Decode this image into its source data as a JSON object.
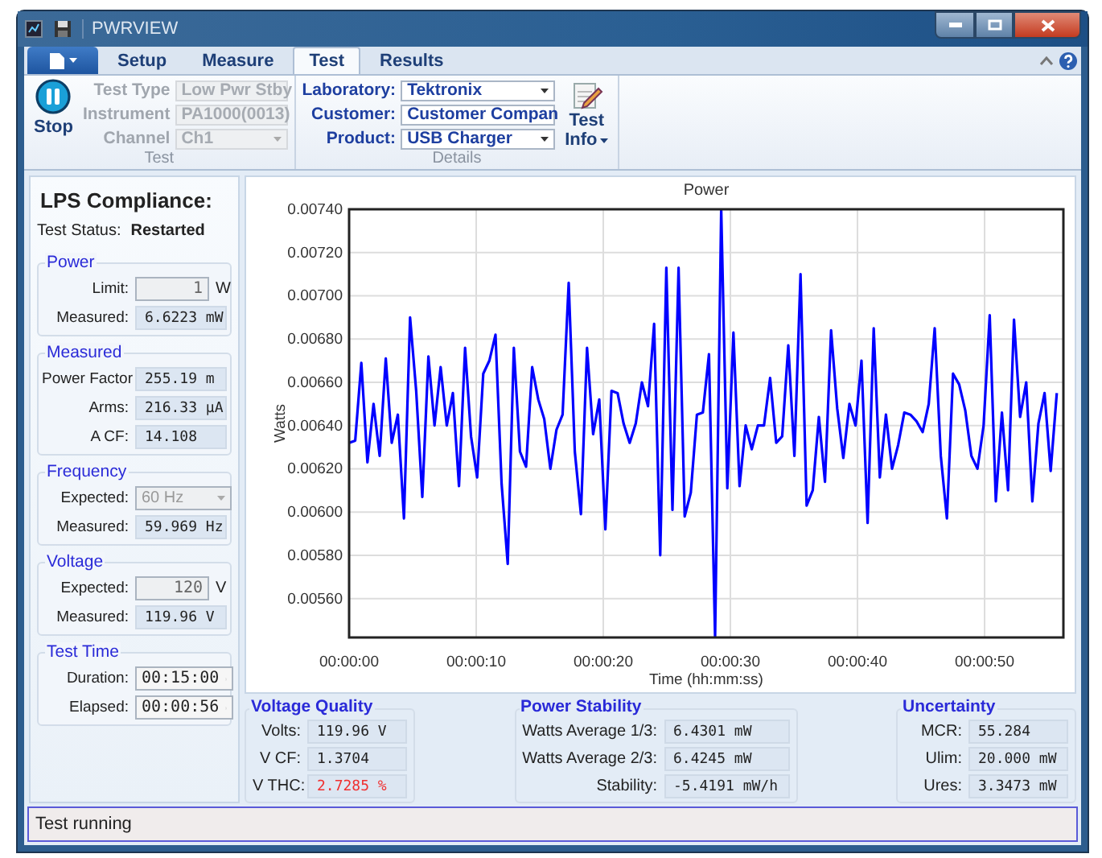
{
  "window": {
    "title": "PWRVIEW"
  },
  "ribbon": {
    "tabs": [
      {
        "label": "Setup",
        "selected": false
      },
      {
        "label": "Measure",
        "selected": false
      },
      {
        "label": "Test",
        "selected": true
      },
      {
        "label": "Results",
        "selected": false
      }
    ],
    "test_group": {
      "label": "Test",
      "stop_button": "Stop",
      "fields": [
        {
          "label": "Test Type",
          "value": "Low Pwr Stby",
          "disabled": true
        },
        {
          "label": "Instrument",
          "value": "PA1000(0013)",
          "disabled": true
        },
        {
          "label": "Channel",
          "value": "Ch1",
          "disabled": true
        }
      ]
    },
    "details_group": {
      "label": "Details",
      "fields": [
        {
          "label": "Laboratory:",
          "value": "Tektronix",
          "disabled": false
        },
        {
          "label": "Customer:",
          "value": "Customer Compan",
          "disabled": false
        },
        {
          "label": "Product:",
          "value": "USB Charger",
          "disabled": false
        }
      ],
      "info_button": [
        "Test",
        "Info"
      ]
    }
  },
  "left_panel": {
    "title": "LPS Compliance:",
    "status_label": "Test Status:",
    "status_value": "Restarted",
    "sections": [
      {
        "title": "Power",
        "rows": [
          {
            "kind": "input",
            "label": "Limit:",
            "value": "1",
            "unit": "W"
          },
          {
            "kind": "readout",
            "label": "Measured:",
            "value": "6.6223 mW"
          }
        ]
      },
      {
        "title": "Measured",
        "rows": [
          {
            "kind": "readout",
            "label": "Power Factor",
            "value": "255.19 m"
          },
          {
            "kind": "readout",
            "label": "Arms:",
            "value": "216.33 µA"
          },
          {
            "kind": "readout",
            "label": "A CF:",
            "value": "14.108"
          }
        ]
      },
      {
        "title": "Frequency",
        "rows": [
          {
            "kind": "select",
            "label": "Expected:",
            "value": "60 Hz",
            "disabled": true
          },
          {
            "kind": "readout",
            "label": "Measured:",
            "value": "59.969 Hz"
          }
        ]
      },
      {
        "title": "Voltage",
        "rows": [
          {
            "kind": "input",
            "label": "Expected:",
            "value": "120",
            "unit": "V"
          },
          {
            "kind": "readout",
            "label": "Measured:",
            "value": "119.96 V"
          }
        ]
      },
      {
        "title": "Test Time",
        "rows": [
          {
            "kind": "spinner",
            "label": "Duration:",
            "value": "00:15:00"
          },
          {
            "kind": "spinner",
            "label": "Elapsed:",
            "value": "00:00:56"
          }
        ]
      }
    ]
  },
  "chart_data": {
    "type": "line",
    "grid": true,
    "title": "Power",
    "xlabel": "Time (hh:mm:ss)",
    "ylabel": "Watts",
    "xlim": [
      0,
      56.2
    ],
    "ylim": [
      0.00542,
      0.0074
    ],
    "xticks": [
      {
        "value": 0,
        "label": "00:00:00"
      },
      {
        "value": 10,
        "label": "00:00:10"
      },
      {
        "value": 20,
        "label": "00:00:20"
      },
      {
        "value": 30,
        "label": "00:00:30"
      },
      {
        "value": 40,
        "label": "00:00:40"
      },
      {
        "value": 50,
        "label": "00:00:50"
      }
    ],
    "yticks": [
      {
        "value": 0.0056,
        "label": "0.00560"
      },
      {
        "value": 0.0058,
        "label": "0.00580"
      },
      {
        "value": 0.006,
        "label": "0.00600"
      },
      {
        "value": 0.0062,
        "label": "0.00620"
      },
      {
        "value": 0.0064,
        "label": "0.00640"
      },
      {
        "value": 0.0066,
        "label": "0.00660"
      },
      {
        "value": 0.0068,
        "label": "0.00680"
      },
      {
        "value": 0.007,
        "label": "0.00700"
      },
      {
        "value": 0.0072,
        "label": "0.00720"
      },
      {
        "value": 0.0074,
        "label": "0.00740"
      }
    ],
    "x": [
      0,
      0.48,
      0.96,
      1.44,
      1.92,
      2.4,
      2.88,
      3.36,
      3.84,
      4.32,
      4.8,
      5.28,
      5.76,
      6.24,
      6.72,
      7.2,
      7.68,
      8.16,
      8.64,
      9.12,
      9.6,
      10.08,
      10.56,
      11.04,
      11.52,
      12,
      12.48,
      12.96,
      13.44,
      13.92,
      14.4,
      14.88,
      15.36,
      15.84,
      16.32,
      16.8,
      17.28,
      17.76,
      18.24,
      18.72,
      19.2,
      19.68,
      20.16,
      20.64,
      21.12,
      21.6,
      22.08,
      22.56,
      23.04,
      23.52,
      24,
      24.48,
      24.96,
      25.44,
      25.92,
      26.4,
      26.88,
      27.36,
      27.84,
      28.32,
      28.8,
      29.28,
      29.76,
      30.24,
      30.72,
      31.2,
      31.68,
      32.16,
      32.64,
      33.12,
      33.6,
      34.08,
      34.56,
      35.04,
      35.52,
      36,
      36.48,
      36.96,
      37.44,
      37.92,
      38.4,
      38.88,
      39.36,
      39.84,
      40.32,
      40.8,
      41.28,
      41.76,
      42.24,
      42.72,
      43.2,
      43.68,
      44.16,
      44.64,
      45.12,
      45.6,
      46.08,
      46.56,
      47.04,
      47.52,
      48,
      48.48,
      48.96,
      49.44,
      49.92,
      50.4,
      50.88,
      51.36,
      51.84,
      52.32,
      52.8,
      53.28,
      53.76,
      54.24,
      54.72,
      55.2,
      55.68
    ],
    "series": [
      {
        "color": "#0000ff",
        "values": [
          0.00632,
          0.00633,
          0.00669,
          0.00623,
          0.0065,
          0.00626,
          0.00671,
          0.00632,
          0.00645,
          0.00597,
          0.0069,
          0.00656,
          0.00607,
          0.00672,
          0.0064,
          0.00667,
          0.0064,
          0.00655,
          0.00612,
          0.00676,
          0.00635,
          0.00616,
          0.00664,
          0.0067,
          0.00682,
          0.00613,
          0.00576,
          0.00676,
          0.00628,
          0.00621,
          0.00667,
          0.00652,
          0.00643,
          0.0062,
          0.00638,
          0.00645,
          0.00706,
          0.00628,
          0.00599,
          0.00676,
          0.00636,
          0.00652,
          0.00592,
          0.00656,
          0.00655,
          0.00641,
          0.00632,
          0.00641,
          0.0066,
          0.00649,
          0.00687,
          0.0058,
          0.00713,
          0.00601,
          0.00713,
          0.00598,
          0.00609,
          0.00645,
          0.00646,
          0.00673,
          0.00542,
          0.0074,
          0.00611,
          0.00683,
          0.00612,
          0.0064,
          0.00629,
          0.0064,
          0.0064,
          0.00662,
          0.00632,
          0.00635,
          0.00677,
          0.00626,
          0.0071,
          0.00603,
          0.0061,
          0.00644,
          0.00614,
          0.00684,
          0.00648,
          0.00625,
          0.0065,
          0.0064,
          0.0067,
          0.00595,
          0.00685,
          0.00616,
          0.00645,
          0.0062,
          0.00631,
          0.00646,
          0.00645,
          0.00642,
          0.00637,
          0.0065,
          0.00685,
          0.00626,
          0.00597,
          0.00664,
          0.00659,
          0.00647,
          0.00626,
          0.0062,
          0.0064,
          0.00691,
          0.00605,
          0.00646,
          0.0061,
          0.00689,
          0.00644,
          0.0066,
          0.00605,
          0.00641,
          0.00655,
          0.00619,
          0.00655
        ]
      }
    ]
  },
  "bottom_groups": [
    {
      "title": "Voltage Quality",
      "rows": [
        {
          "label": "Volts:",
          "value": "119.96 V",
          "alert": false
        },
        {
          "label": "V CF:",
          "value": "1.3704",
          "alert": false
        },
        {
          "label": "V THC:",
          "value": "2.7285 %",
          "alert": true
        }
      ]
    },
    {
      "title": "Power Stability",
      "rows": [
        {
          "label": "Watts Average 1/3:",
          "value": "6.4301 mW",
          "alert": false
        },
        {
          "label": "Watts Average 2/3:",
          "value": "6.4245 mW",
          "alert": false
        },
        {
          "label": "Stability:",
          "value": "-5.4191 mW/h",
          "alert": false
        }
      ]
    },
    {
      "title": "Uncertainty",
      "rows": [
        {
          "label": "MCR:",
          "value": "55.284",
          "alert": false
        },
        {
          "label": "Ulim:",
          "value": "20.000 mW",
          "alert": false
        },
        {
          "label": "Ures:",
          "value": "3.3473 mW",
          "alert": false
        }
      ]
    }
  ],
  "status_bar": {
    "text": "Test running"
  }
}
